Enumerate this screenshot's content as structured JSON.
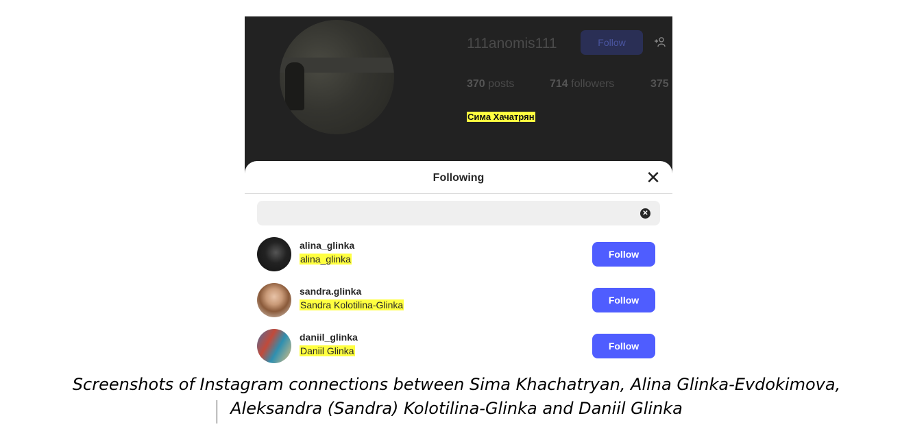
{
  "profile": {
    "username": "111anomis111",
    "follow_label": "Follow",
    "posts_count": "370",
    "posts_label": "posts",
    "followers_count": "714",
    "followers_label": "followers",
    "following_count": "375",
    "display_name": "Сима Хачатрян",
    "add_user_icon": "add-user-icon"
  },
  "modal": {
    "title": "Following",
    "close_icon": "close-icon",
    "search_value": "",
    "clear_icon": "clear-icon",
    "users": [
      {
        "handle": "alina_glinka",
        "full_name": "alina_glinka",
        "button": "Follow"
      },
      {
        "handle": "sandra.glinka",
        "full_name": "Sandra Kolotilina-Glinka",
        "button": "Follow"
      },
      {
        "handle": "daniil_glinka",
        "full_name": "Daniil Glinka",
        "button": "Follow"
      }
    ]
  },
  "colors": {
    "highlight": "#ffff40",
    "follow_button": "#4f5dff",
    "overlay": "#222222"
  },
  "caption": {
    "line1": "Screenshots of Instagram connections between Sima Khachatryan, Alina Glinka-Evdokimova,",
    "line2": "Aleksandra (Sandra) Kolotilina-Glinka and Daniil Glinka"
  }
}
